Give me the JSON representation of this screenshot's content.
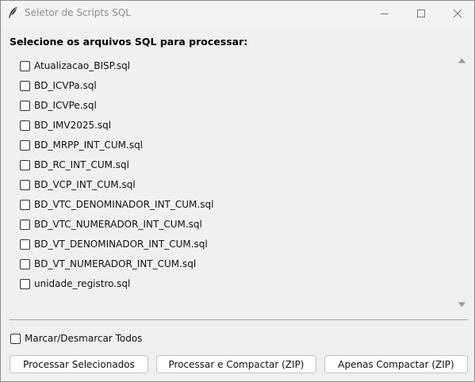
{
  "window": {
    "title": "Seletor de Scripts SQL",
    "app_icon": "feather-icon"
  },
  "heading": "Selecione os arquivos SQL para processar:",
  "files": [
    {
      "label": "Atualizacao_BISP.sql",
      "checked": false
    },
    {
      "label": "BD_ICVPa.sql",
      "checked": false
    },
    {
      "label": "BD_ICVPe.sql",
      "checked": false
    },
    {
      "label": "BD_IMV2025.sql",
      "checked": false
    },
    {
      "label": "BD_MRPP_INT_CUM.sql",
      "checked": false
    },
    {
      "label": "BD_RC_INT_CUM.sql",
      "checked": false
    },
    {
      "label": "BD_VCP_INT_CUM.sql",
      "checked": false
    },
    {
      "label": "BD_VTC_DENOMINADOR_INT_CUM.sql",
      "checked": false
    },
    {
      "label": "BD_VTC_NUMERADOR_INT_CUM.sql",
      "checked": false
    },
    {
      "label": "BD_VT_DENOMINADOR_INT_CUM.sql",
      "checked": false
    },
    {
      "label": "BD_VT_NUMERADOR_INT_CUM.sql",
      "checked": false
    },
    {
      "label": "unidade_registro.sql",
      "checked": false
    }
  ],
  "select_all": {
    "label": "Marcar/Desmarcar Todos",
    "checked": false
  },
  "buttons": {
    "process": "Processar Selecionados",
    "process_zip": "Processar e Compactar (ZIP)",
    "zip_only": "Apenas Compactar (ZIP)"
  },
  "colors": {
    "window_bg": "#f0f0f0",
    "titlebar_bg": "#f3f3f3",
    "title_text": "#8e8e8e",
    "button_border": "#c4c4c4"
  }
}
